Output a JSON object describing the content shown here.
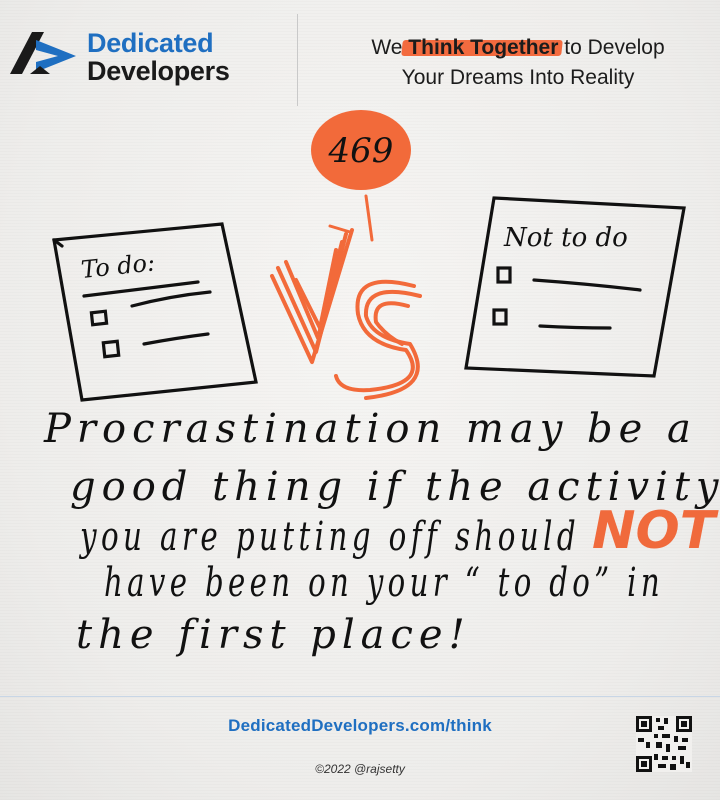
{
  "brand": {
    "line1": "Dedicated",
    "line2": "Developers",
    "color_primary": "#1f6fc1",
    "color_dark": "#1a1a1a"
  },
  "tagline": {
    "prefix": "We",
    "highlight": "Think Together",
    "suffix": "to Develop",
    "line2": "Your Dreams Into Reality",
    "accent": "#f36b3f"
  },
  "illustration": {
    "number": "469",
    "todo_title": "To do:",
    "nottodo_title": "Not to do",
    "vs_label": "VS"
  },
  "message": {
    "line1": "Procrastination may be a",
    "line2": "good thing if the activity",
    "line3": "you are putting off should",
    "emphasis": "NOT",
    "line4": "have been on your “ to do” in",
    "line5": "the first place!"
  },
  "footer": {
    "url": "DedicatedDevelopers.com/think",
    "copyright": "©2022 @rajsetty",
    "qr_icon": "qr-code-icon"
  }
}
